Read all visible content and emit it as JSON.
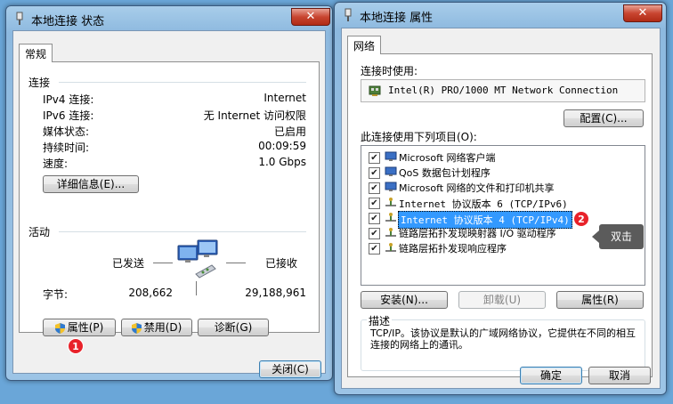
{
  "status_window": {
    "title": "本地连接 状态",
    "close": "✕",
    "tab": "常规",
    "connection_heading": "连接",
    "rows": [
      {
        "label": "IPv4 连接:",
        "value": "Internet"
      },
      {
        "label": "IPv6 连接:",
        "value": "无 Internet 访问权限"
      },
      {
        "label": "媒体状态:",
        "value": "已启用"
      },
      {
        "label": "持续时间:",
        "value": "00:09:59"
      },
      {
        "label": "速度:",
        "value": "1.0 Gbps"
      }
    ],
    "details_button": "详细信息(E)...",
    "activity_heading": "活动",
    "sent_label": "已发送",
    "received_label": "已接收",
    "bytes_label": "字节:",
    "bytes_sent": "208,662",
    "bytes_received": "29,188,961",
    "properties_button": "属性(P)",
    "disable_button": "禁用(D)",
    "diagnose_button": "诊断(G)",
    "close_button": "关闭(C)",
    "badge": "1"
  },
  "properties_window": {
    "title": "本地连接 属性",
    "close": "✕",
    "tab": "网络",
    "connect_using_label": "连接时使用:",
    "adapter": "Intel(R) PRO/1000 MT Network Connection",
    "configure_button": "配置(C)...",
    "items_label": "此连接使用下列项目(O):",
    "items": [
      {
        "label": "Microsoft 网络客户端",
        "checked": true,
        "selected": false
      },
      {
        "label": "QoS 数据包计划程序",
        "checked": true,
        "selected": false
      },
      {
        "label": "Microsoft 网络的文件和打印机共享",
        "checked": true,
        "selected": false
      },
      {
        "label": "Internet 协议版本 6 (TCP/IPv6)",
        "checked": true,
        "selected": false
      },
      {
        "label": "Internet 协议版本 4 (TCP/IPv4)",
        "checked": true,
        "selected": true
      },
      {
        "label": "链路层拓扑发现映射器 I/O 驱动程序",
        "checked": true,
        "selected": false
      },
      {
        "label": "链路层拓扑发现响应程序",
        "checked": true,
        "selected": false
      }
    ],
    "install_button": "安装(N)...",
    "uninstall_button": "卸载(U)",
    "properties_button": "属性(R)",
    "description_heading": "描述",
    "description": "TCP/IP。该协议是默认的广域网络协议，它提供在不同的相互连接的网络上的通讯。",
    "ok_button": "确定",
    "cancel_button": "取消",
    "badge": "2",
    "callout": "双击"
  },
  "colors": {
    "selection": "#3399ff",
    "badge": "#e8222a",
    "callout_bg": "#5b5b5b"
  }
}
